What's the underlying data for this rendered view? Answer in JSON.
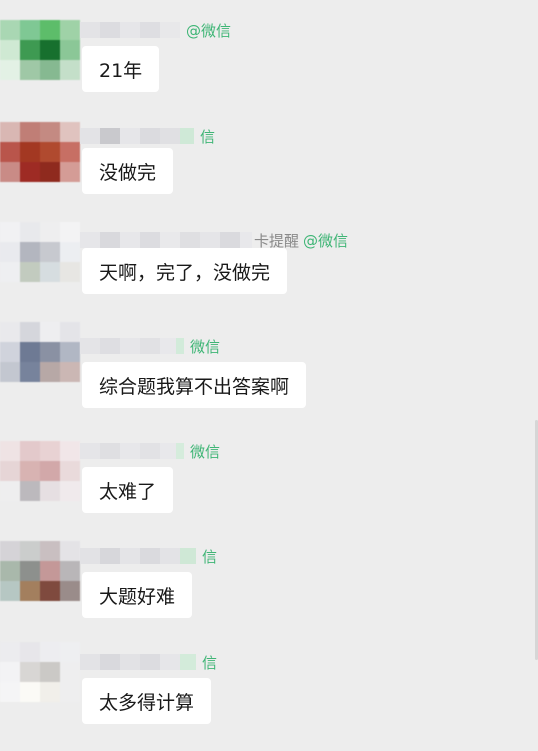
{
  "messages": [
    {
      "sender_suffix": "",
      "sender_tag": "@微信",
      "text": "21年",
      "avatar": [
        "#a9d7b3",
        "#7fc894",
        "#5dbd6a",
        "#9fd2a7",
        "#cfe9d3",
        "#3e9a52",
        "#17702e",
        "#8bc797",
        "#e3f1e5",
        "#9fc8a6",
        "#86b991",
        "#c4dfc9"
      ]
    },
    {
      "sender_suffix": "",
      "sender_tag": "信",
      "text": "没做完",
      "avatar": [
        "#d9b7b3",
        "#c07e76",
        "#c48a82",
        "#e0c3bf",
        "#b9554b",
        "#a33822",
        "#b04a2f",
        "#c76f64",
        "#c98b86",
        "#9e2b24",
        "#8f2a1e",
        "#d49c96"
      ]
    },
    {
      "sender_suffix": "卡提醒",
      "sender_tag": "@微信",
      "text": "天啊，完了，没做完",
      "avatar": [
        "#f1f1f3",
        "#e8e9ec",
        "#eeeeef",
        "#f3f3f4",
        "#e9eaee",
        "#b3b6bf",
        "#c7c9cf",
        "#eceef1",
        "#eeeff1",
        "#c2cbbf",
        "#d6dde0",
        "#e7e6e3"
      ]
    },
    {
      "sender_suffix": "",
      "sender_tag": "微信",
      "text": "综合题我算不出答案啊",
      "avatar": [
        "#e9e9ec",
        "#d5d6dc",
        "#eeeef0",
        "#e4e4e8",
        "#d0d3dc",
        "#6e7a94",
        "#8a91a3",
        "#b1b7c4",
        "#c3c7d0",
        "#77839c",
        "#b7a8a6",
        "#cbb7b4"
      ]
    },
    {
      "sender_suffix": "",
      "sender_tag": "微信",
      "text": "太难了",
      "avatar": [
        "#efe3e4",
        "#e3c9cb",
        "#e8d2d3",
        "#f1e6e8",
        "#e6d5d6",
        "#d8b3b2",
        "#d2a8a9",
        "#e9dadb",
        "#eeeeef",
        "#bcb9bd",
        "#e6dfe2",
        "#f0eaec"
      ]
    },
    {
      "sender_suffix": "",
      "sender_tag": "信",
      "text": "大题好难",
      "avatar": [
        "#d5d3d7",
        "#cbcdcc",
        "#c9bfc1",
        "#e4e3e6",
        "#a9b8ab",
        "#8d908d",
        "#c49898",
        "#b9b6b8",
        "#b6c7c3",
        "#a37f5e",
        "#7f4a3e",
        "#9a8c8a"
      ]
    },
    {
      "sender_suffix": "",
      "sender_tag": "信",
      "text": "太多得计算",
      "avatar": [
        "#ececef",
        "#e7e6ea",
        "#ededf0",
        "#eeeff1",
        "#f3f3f5",
        "#d8d6d4",
        "#cbc9c6",
        "#eeeeef",
        "#f5f5f6",
        "#fbfaf6",
        "#f1efea",
        "#eeeeef"
      ]
    }
  ],
  "colors": {
    "background": "#ededed",
    "bubble": "#ffffff",
    "tag": "#3eb575",
    "name": "#8a8a8a",
    "text": "#191919"
  }
}
